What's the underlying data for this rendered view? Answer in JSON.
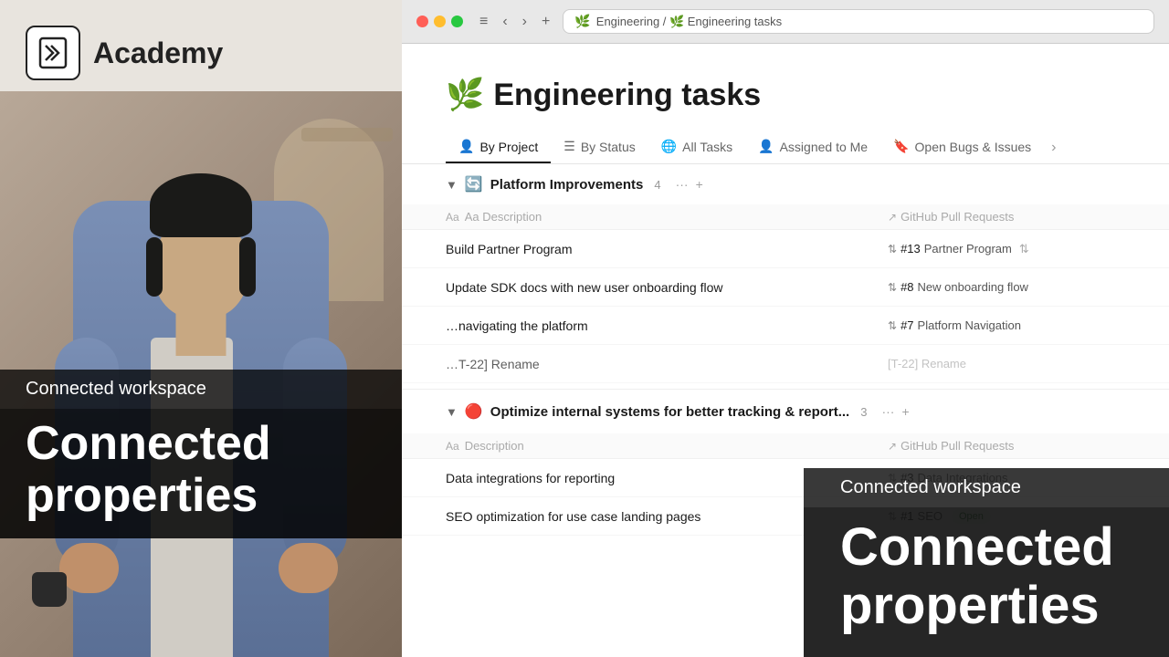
{
  "left_panel": {
    "logo_text": "N",
    "academy_label": "Academy",
    "subtitle": "Connected workspace",
    "main_title": "Connected properties"
  },
  "browser": {
    "traffic_lights": [
      "red",
      "yellow",
      "green"
    ],
    "breadcrumb": "Engineering / 🌿 Engineering tasks",
    "back_btn": "‹",
    "forward_btn": "›",
    "add_btn": "+",
    "menu_btn": "≡"
  },
  "notion_page": {
    "title_emoji": "🌿",
    "title": "Engineering tasks",
    "tabs": [
      {
        "id": "by-project",
        "icon": "👤",
        "label": "By Project",
        "active": true
      },
      {
        "id": "by-status",
        "icon": "☰",
        "label": "By Status",
        "active": false
      },
      {
        "id": "all-tasks",
        "icon": "🌐",
        "label": "All Tasks",
        "active": false
      },
      {
        "id": "assigned",
        "icon": "👤",
        "label": "Assigned to Me",
        "active": false
      },
      {
        "id": "bugs",
        "icon": "🔖",
        "label": "Open Bugs & Issues",
        "active": false
      }
    ]
  },
  "group1": {
    "toggle": "▼",
    "emoji": "🔄",
    "title": "Platform Improvements",
    "count": "4",
    "col_header_main": "Aa Description",
    "col_header_right": "↗ GitHub Pull Requests",
    "rows": [
      {
        "title": "Build Partner Program",
        "pr_icon": "⇅",
        "pr_number": "#13",
        "pr_name": "Partner Program"
      },
      {
        "title": "Update SDK docs with new user onboarding flow",
        "pr_icon": "⇅",
        "pr_number": "#8",
        "pr_name": "New onboarding flow"
      },
      {
        "title": "…navigating the platform",
        "pr_icon": "⇅",
        "pr_number": "#7",
        "pr_name": "Platform Navigation"
      },
      {
        "title": "…T-22] Rename",
        "pr_icon": "",
        "pr_number": "",
        "pr_name": ""
      }
    ]
  },
  "group2": {
    "toggle": "▼",
    "emoji": "🔴",
    "title": "Optimize internal systems for better tracking & report...",
    "count": "3",
    "col_header_main": "Aa Description",
    "col_header_right": "↗ GitHub Pull Requests",
    "rows": [
      {
        "title": "Data integrations for reporting",
        "pr_icon": "⇅",
        "pr_number": "#3",
        "pr_name": "Data Integrations"
      },
      {
        "title": "SEO optimization for use case landing pages",
        "pr_icon": "⇅",
        "pr_number": "#1",
        "pr_name": "SEO",
        "badge": "Open"
      }
    ]
  },
  "overlay": {
    "subtitle": "Connected workspace",
    "main_title": "Connected properties"
  }
}
